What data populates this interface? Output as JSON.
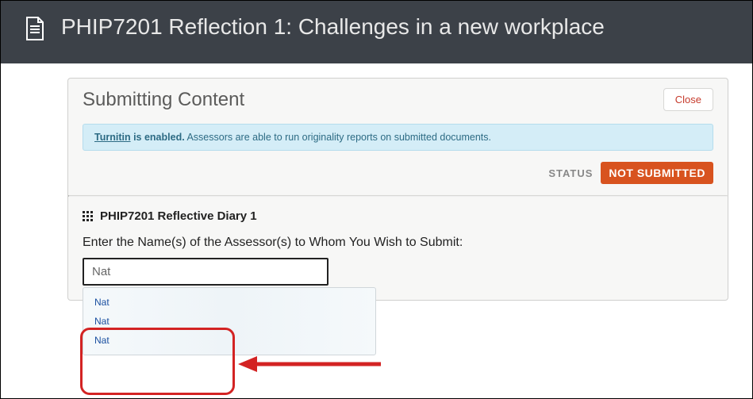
{
  "header": {
    "title": "PHIP7201 Reflection 1: Challenges in a new workplace"
  },
  "panel": {
    "title": "Submitting Content",
    "close_label": "Close"
  },
  "info": {
    "turnitin": "Turnitin",
    "enabled": " is enabled.",
    "rest": " Assessors are able to run originality reports on submitted documents."
  },
  "status": {
    "label": "STATUS",
    "value": "NOT SUBMITTED"
  },
  "form": {
    "assignment_title": "PHIP7201 Reflective Diary 1",
    "assessor_label": "Enter the Name(s) of the Assessor(s) to Whom You Wish to Submit:",
    "assessor_value": "Nat",
    "suggestions": [
      "Nat",
      "Nat",
      "Nat"
    ]
  }
}
